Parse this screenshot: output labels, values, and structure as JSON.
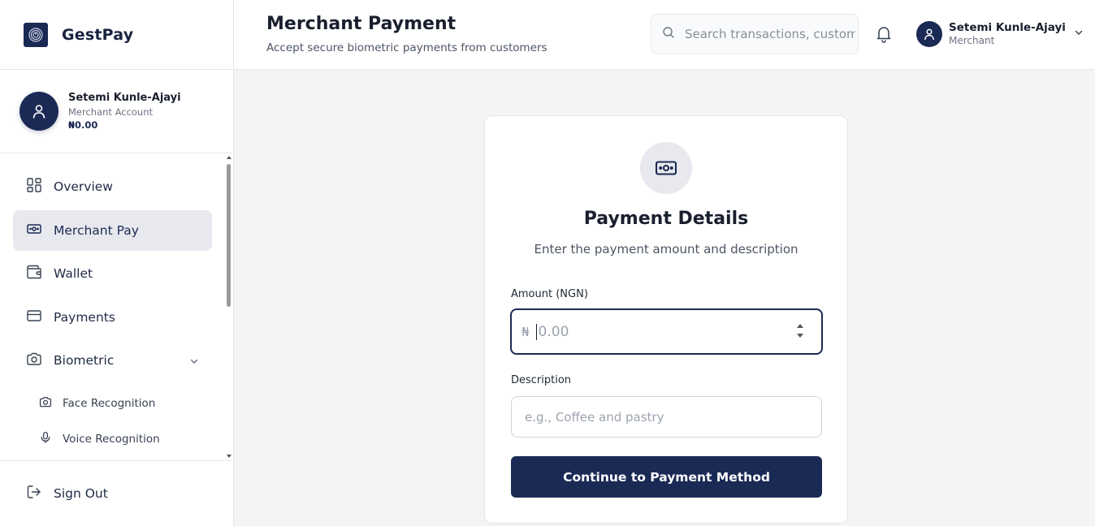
{
  "brand": {
    "name": "GestPay",
    "logo_icon": "fingerprint-icon",
    "accent": "#1b2a55"
  },
  "profile": {
    "name": "Setemi Kunle-Ajayi",
    "role": "Merchant Account",
    "balance": "₦0.00",
    "avatar_icon": "user-icon"
  },
  "nav": {
    "items": [
      {
        "label": "Overview",
        "icon": "grid-icon",
        "active": false
      },
      {
        "label": "Merchant Pay",
        "icon": "banknote-icon",
        "active": true
      },
      {
        "label": "Wallet",
        "icon": "wallet-icon",
        "active": false
      },
      {
        "label": "Payments",
        "icon": "credit-card-icon",
        "active": false
      },
      {
        "label": "Biometric",
        "icon": "camera-icon",
        "active": false,
        "expanded": true
      }
    ],
    "sub_items": [
      {
        "label": "Face Recognition",
        "icon": "camera-icon"
      },
      {
        "label": "Voice Recognition",
        "icon": "microphone-icon"
      }
    ],
    "signout_label": "Sign Out"
  },
  "header": {
    "title": "Merchant Payment",
    "subtitle": "Accept secure biometric payments from customers",
    "search_placeholder": "Search transactions, customers...",
    "user": {
      "name": "Setemi Kunle-Ajayi",
      "role": "Merchant"
    }
  },
  "card": {
    "icon": "banknote-icon",
    "title": "Payment Details",
    "subtitle": "Enter the payment amount and description",
    "amount_label": "Amount (NGN)",
    "currency_symbol": "₦",
    "amount_placeholder": "0.00",
    "amount_value": "",
    "description_label": "Description",
    "description_placeholder": "e.g., Coffee and pastry",
    "description_value": "",
    "continue_label": "Continue to Payment Method"
  }
}
